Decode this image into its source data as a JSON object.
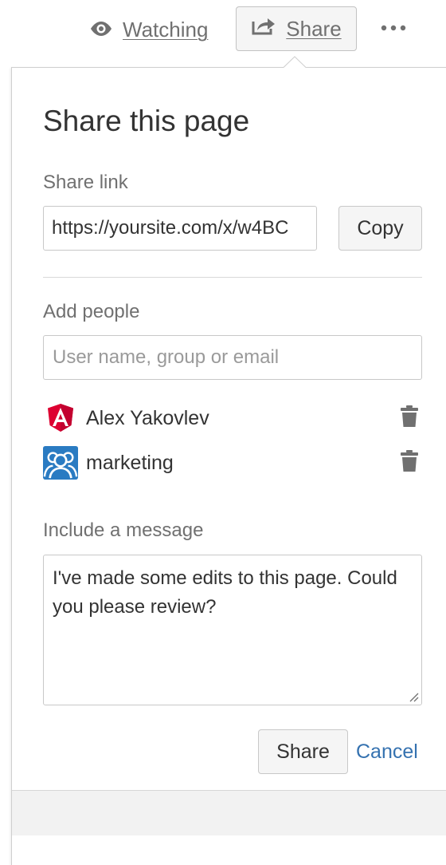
{
  "toolbar": {
    "watch_label": "Watching",
    "watch_icon": "eye-icon",
    "share_label": "Share",
    "share_icon": "share-arrow-icon",
    "more_icon": "more-dots-icon"
  },
  "dialog": {
    "title": "Share this page",
    "share_link": {
      "label": "Share link",
      "value": "https://yoursite.com/x/w4BC",
      "copy_label": "Copy"
    },
    "add_people": {
      "label": "Add people",
      "placeholder": "User name, group or email",
      "people": [
        {
          "name": "Alex Yakovlev",
          "avatar": "angular-avatar",
          "remove_icon": "trash-icon"
        },
        {
          "name": "marketing",
          "avatar": "group-avatar",
          "remove_icon": "trash-icon"
        }
      ]
    },
    "message": {
      "label": "Include a message",
      "value": "I've made some edits to this page. Could you please review?"
    },
    "actions": {
      "share_label": "Share",
      "cancel_label": "Cancel"
    }
  },
  "colors": {
    "link_blue": "#3572b0",
    "angular_red": "#dd0031",
    "group_blue": "#2a7bc2",
    "muted_text": "#707070"
  }
}
